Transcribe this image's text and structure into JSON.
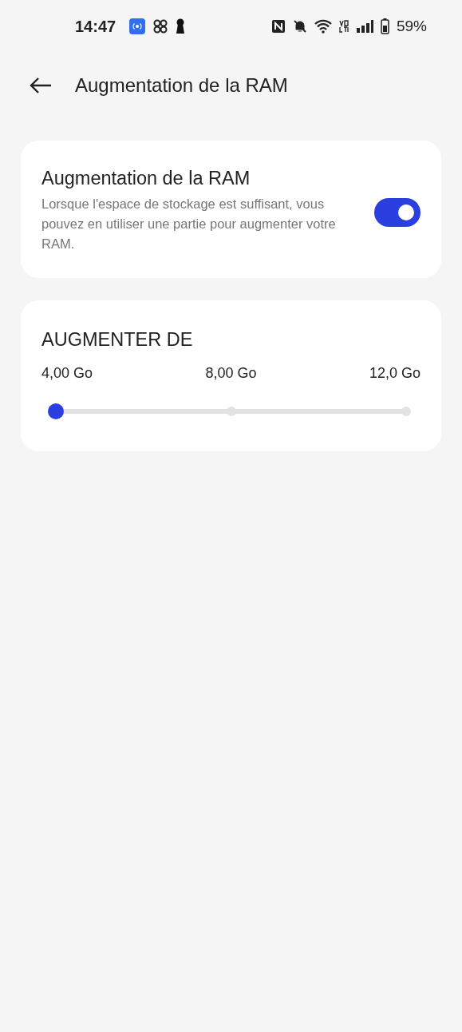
{
  "status_bar": {
    "time": "14:47",
    "battery": "59%"
  },
  "header": {
    "title": "Augmentation de la RAM"
  },
  "toggle_card": {
    "title": "Augmentation de la RAM",
    "description": "Lorsque l'espace de stockage est suffisant, vous pouvez en utiliser une partie pour augmenter votre RAM.",
    "on": true
  },
  "slider_card": {
    "title": "AUGMENTER DE",
    "steps": [
      "4,00 Go",
      "8,00 Go",
      "12,0 Go"
    ],
    "level": 0
  }
}
